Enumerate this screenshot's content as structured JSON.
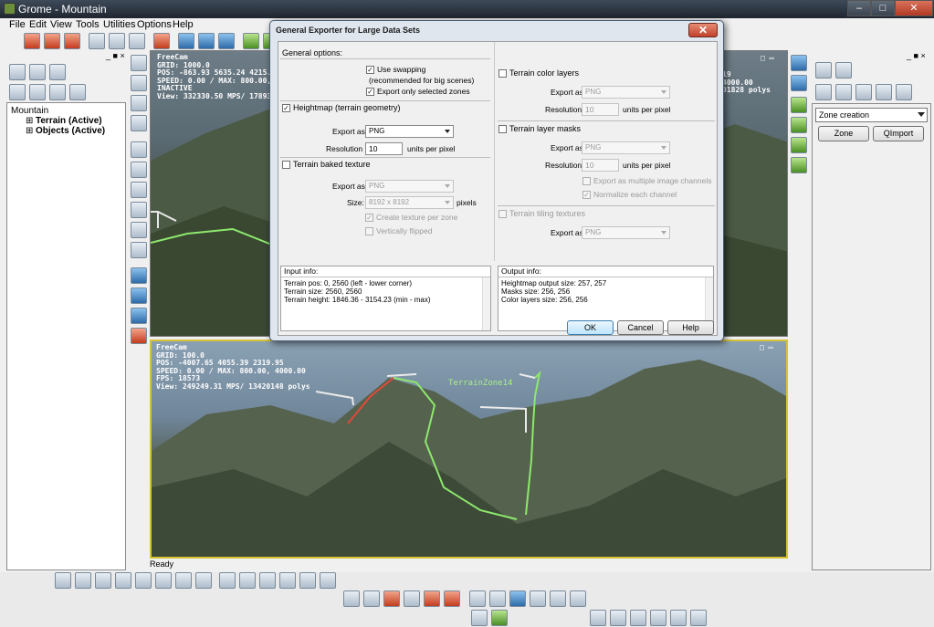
{
  "window": {
    "title": "Grome - Mountain",
    "min": "–",
    "max": "□",
    "close": "✕"
  },
  "menu": [
    "File",
    "Edit",
    "View",
    "Tools",
    "Utilities",
    "Options",
    "Help"
  ],
  "left_panel": {
    "header_buttons": "_ ■ ×",
    "tree": {
      "root": "Mountain",
      "children": [
        "Terrain (Active)",
        "Objects (Active)"
      ],
      "expanders": [
        "⊞",
        "⊞"
      ]
    }
  },
  "right_panel": {
    "header_buttons": "_ ■ ×",
    "mode": "Zone creation",
    "buttons": [
      "Zone",
      "QImport"
    ]
  },
  "viewport_top": {
    "hud": [
      "FreeCam",
      "GRID: 1000.0",
      "POS: -863.93 5635.24 4215.61",
      "SPEED: 0.00 / MAX: 800.00, 4000",
      "INACTIVE",
      "View: 332330.50 MPS/ 1789342"
    ],
    "hud_right": [
      "19",
      "4000.00",
      "01828 polys"
    ],
    "corner": "□ ▭"
  },
  "viewport_bottom": {
    "hud": [
      "FreeCam",
      "GRID: 100.0",
      "POS: -4007.65 4055.39 2319.95",
      "SPEED: 0.00 / MAX: 800.00, 4000.00",
      "FPS: 18573",
      "View: 249249.31 MPS/ 13420148 polys"
    ],
    "zone_label": "TerrainZone14",
    "corner": "□ ▭"
  },
  "status": "Ready",
  "dialog": {
    "title": "General Exporter for Large Data Sets",
    "close": "✕",
    "general": {
      "title": "General options:",
      "use_swapping": "Use swapping",
      "use_swapping_note": "(recommended for big scenes)",
      "export_selected": "Export only selected zones"
    },
    "heightmap": {
      "title": "Heightmap (terrain geometry)",
      "export_as_label": "Export as",
      "export_as_value": "PNG",
      "resolution_label": "Resolution",
      "resolution_value": "10",
      "units": "units per pixel"
    },
    "baked": {
      "title": "Terrain baked texture",
      "export_as_label": "Export as",
      "export_as_value": "PNG",
      "size_label": "Size:",
      "size_value": "8192 x 8192",
      "size_units": "pixels",
      "per_zone": "Create texture per zone",
      "flipped": "Vertically flipped"
    },
    "color_layers": {
      "title": "Terrain color layers",
      "export_as_label": "Export as",
      "export_as_value": "PNG",
      "resolution_label": "Resolution",
      "resolution_value": "10",
      "units": "units per pixel"
    },
    "layer_masks": {
      "title": "Terrain layer masks",
      "export_as_label": "Export as",
      "export_as_value": "PNG",
      "resolution_label": "Resolution",
      "resolution_value": "10",
      "units": "units per pixel",
      "multi_channel": "Export as multiple image channels",
      "normalize": "Normalize each channel"
    },
    "tiling": {
      "title": "Terrain tiling textures",
      "export_as_label": "Export as",
      "export_as_value": "PNG"
    },
    "input_info": {
      "title": "Input info:",
      "lines": [
        "Terrain pos: 0, 2560 (left - lower corner)",
        "Terrain size: 2560, 2560",
        "Terrain height: 1846.36 - 3154.23 (min - max)"
      ]
    },
    "output_info": {
      "title": "Output info:",
      "lines": [
        "Heightmap output size: 257, 257",
        "Masks size: 256, 256",
        "Color layers size: 256, 256"
      ]
    },
    "buttons": {
      "ok": "OK",
      "cancel": "Cancel",
      "help": "Help"
    },
    "check_mark": "✓"
  }
}
